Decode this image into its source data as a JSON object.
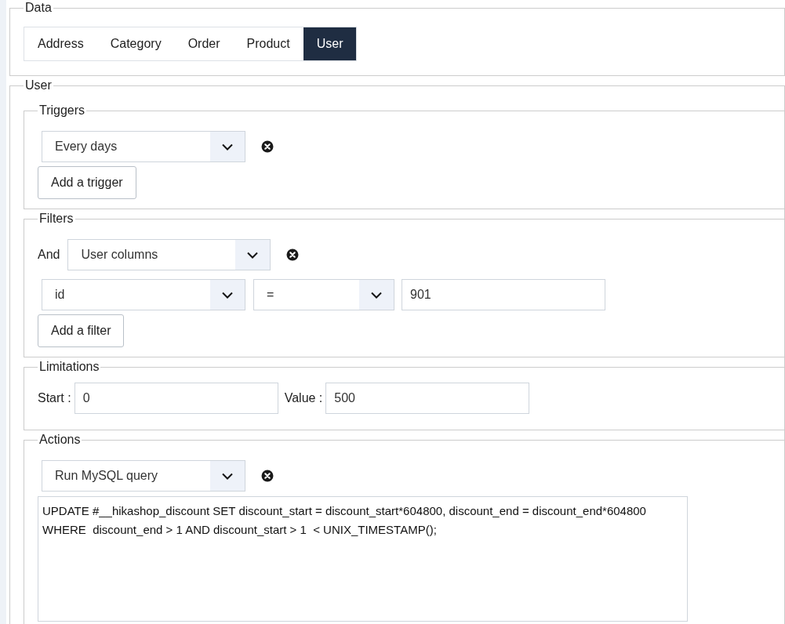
{
  "data": {
    "legend": "Data",
    "tabs": [
      {
        "label": "Address",
        "selected": false
      },
      {
        "label": "Category",
        "selected": false
      },
      {
        "label": "Order",
        "selected": false
      },
      {
        "label": "Product",
        "selected": false
      },
      {
        "label": "User",
        "selected": true
      }
    ]
  },
  "user": {
    "legend": "User",
    "triggers": {
      "legend": "Triggers",
      "rows": [
        {
          "value": "Every days"
        }
      ],
      "add_button": "Add a trigger"
    },
    "filters": {
      "legend": "Filters",
      "rows": [
        {
          "kind": "group",
          "prefix": "And",
          "value": "User columns"
        },
        {
          "kind": "condition",
          "column": "id",
          "operator": "=",
          "value": "901"
        }
      ],
      "add_button": "Add a filter"
    },
    "limitations": {
      "legend": "Limitations",
      "start_label": "Start :",
      "start": "0",
      "value_label": "Value :",
      "value": "500"
    },
    "actions": {
      "legend": "Actions",
      "action": "Run MySQL query",
      "query": "UPDATE #__hikashop_discount SET discount_start = discount_start*604800, discount_end = discount_end*604800\nWHERE  discount_end > 1 AND discount_start > 1  < UNIX_TIMESTAMP();"
    }
  }
}
